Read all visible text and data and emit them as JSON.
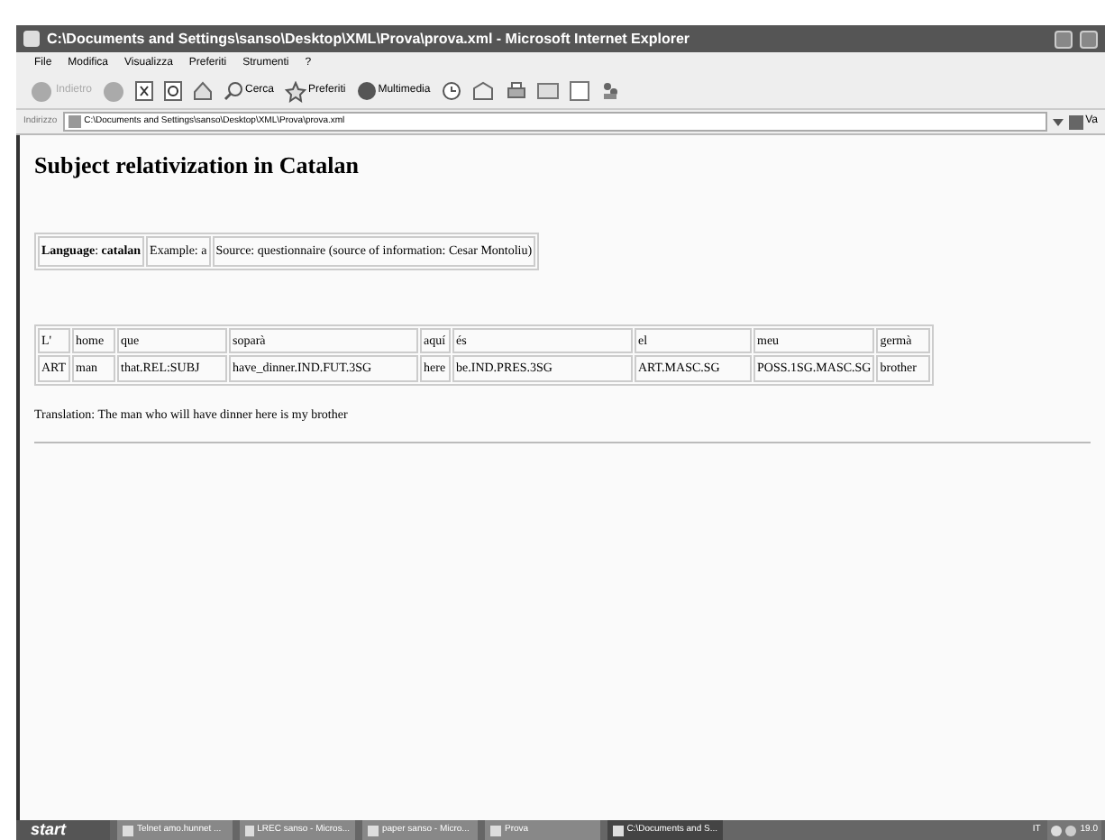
{
  "window": {
    "title": "C:\\Documents and Settings\\sanso\\Desktop\\XML\\Prova\\prova.xml - Microsoft Internet Explorer"
  },
  "menu": [
    "File",
    "Modifica",
    "Visualizza",
    "Preferiti",
    "Strumenti",
    "?"
  ],
  "toolbar": {
    "back": "Indietro",
    "search": "Cerca",
    "favorites": "Preferiti",
    "media": "Multimedia"
  },
  "address": {
    "label": "Indirizzo",
    "value": "C:\\Documents and Settings\\sanso\\Desktop\\XML\\Prova\\prova.xml",
    "go": "Va"
  },
  "page": {
    "heading": "Subject relativization in Catalan",
    "info": [
      "**Language**: **catalan**",
      "Example: a",
      "Source: questionnaire (source of information: Cesar Montoliu)"
    ],
    "gloss": [
      [
        "L'",
        "home",
        "que",
        "soparà",
        "aquí",
        "és",
        "el",
        "meu",
        "germà"
      ],
      [
        "ART",
        "man",
        "that.REL:SUBJ",
        "have_dinner.IND.FUT.3SG",
        "here",
        "be.IND.PRES.3SG",
        "ART.MASC.SG",
        "POSS.1SG.MASC.SG",
        "brother"
      ]
    ],
    "translation": "Translation: The man who will have dinner here is my brother"
  },
  "taskbar": {
    "start": "start",
    "tasks": [
      {
        "label": "Telnet amo.hunnet ...",
        "selected": false
      },
      {
        "label": "LREC sanso - Micros...",
        "selected": false
      },
      {
        "label": "paper sanso - Micro...",
        "selected": false
      },
      {
        "label": "Prova",
        "selected": false
      },
      {
        "label": "C:\\Documents and S...",
        "selected": true
      }
    ],
    "language": "IT",
    "clock": "19.0"
  }
}
